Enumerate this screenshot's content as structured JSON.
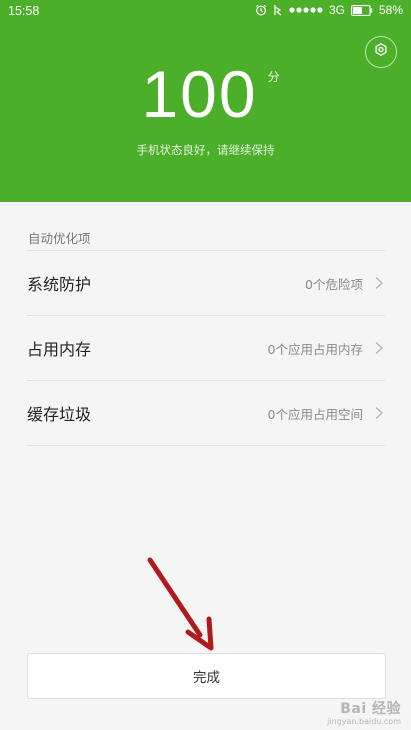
{
  "colors": {
    "accent": "#4caf2a",
    "annotation_arrow": "#b0191e"
  },
  "status_bar": {
    "time": "15:58",
    "network": "3G",
    "battery_percent": "58%",
    "battery_level": 0.58,
    "icons": [
      "alarm-icon",
      "vibrate-icon",
      "signal-icon",
      "battery-icon"
    ]
  },
  "header": {
    "settings_icon": "gear-icon",
    "score": "100",
    "score_unit": "分",
    "status_text": "手机状态良好，请继续保持"
  },
  "auto_optimize": {
    "title": "自动优化项",
    "items": [
      {
        "label": "系统防护",
        "value": "0个危险项"
      },
      {
        "label": "占用内存",
        "value": "0个应用占用内存"
      },
      {
        "label": "缓存垃圾",
        "value": "0个应用占用空间"
      }
    ]
  },
  "footer": {
    "done_label": "完成"
  },
  "watermark": {
    "logo": "Bai 经验",
    "sub": "jingyan.baidu.com"
  }
}
